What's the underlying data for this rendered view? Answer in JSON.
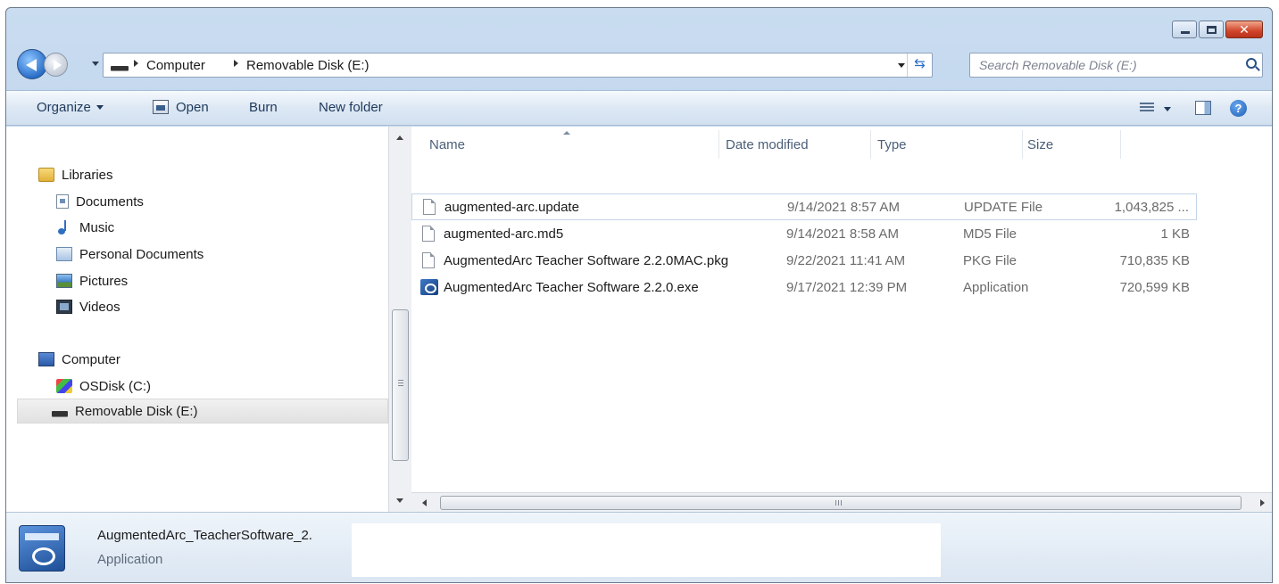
{
  "window": {
    "caption_buttons": [
      "minimize",
      "maximize",
      "close"
    ]
  },
  "address": {
    "breadcrumbs": [
      "Computer",
      "Removable Disk (E:)"
    ],
    "search_placeholder": "Search Removable Disk (E:)"
  },
  "toolbar": {
    "organize": "Organize",
    "open": "Open",
    "burn": "Burn",
    "new_folder": "New folder"
  },
  "nav": {
    "libraries": {
      "label": "Libraries",
      "items": [
        {
          "label": "Documents",
          "icon": "documents-icon"
        },
        {
          "label": "Music",
          "icon": "music-icon"
        },
        {
          "label": "Personal Documents",
          "icon": "personal-documents-icon"
        },
        {
          "label": "Pictures",
          "icon": "pictures-icon"
        },
        {
          "label": "Videos",
          "icon": "videos-icon"
        }
      ]
    },
    "computer": {
      "label": "Computer",
      "items": [
        {
          "label": "OSDisk (C:)",
          "icon": "osdisk-icon"
        },
        {
          "label": "Removable Disk (E:)",
          "icon": "removable-disk-icon",
          "selected": true
        }
      ]
    }
  },
  "files": {
    "columns": [
      "Name",
      "Date modified",
      "Type",
      "Size"
    ],
    "rows": [
      {
        "name": "augmented-arc.update",
        "date": "9/14/2021 8:57 AM",
        "type": "UPDATE File",
        "size": "1,043,825 ...",
        "icon": "file-icon"
      },
      {
        "name": "augmented-arc.md5",
        "date": "9/14/2021 8:58 AM",
        "type": "MD5 File",
        "size": "1 KB",
        "icon": "file-icon"
      },
      {
        "name": "AugmentedArc Teacher Software 2.2.0MAC.pkg",
        "date": "9/22/2021 11:41 AM",
        "type": "PKG File",
        "size": "710,835 KB",
        "icon": "file-icon"
      },
      {
        "name": "AugmentedArc Teacher Software 2.2.0.exe",
        "date": "9/17/2021 12:39 PM",
        "type": "Application",
        "size": "720,599 KB",
        "icon": "application-icon"
      }
    ]
  },
  "details": {
    "name": "AugmentedArc_TeacherSoftware_2.",
    "type": "Application"
  },
  "colors": {
    "window_frame": "#b9d0ea",
    "toolbar_text": "#1e395b",
    "close_button": "#d0452a"
  }
}
